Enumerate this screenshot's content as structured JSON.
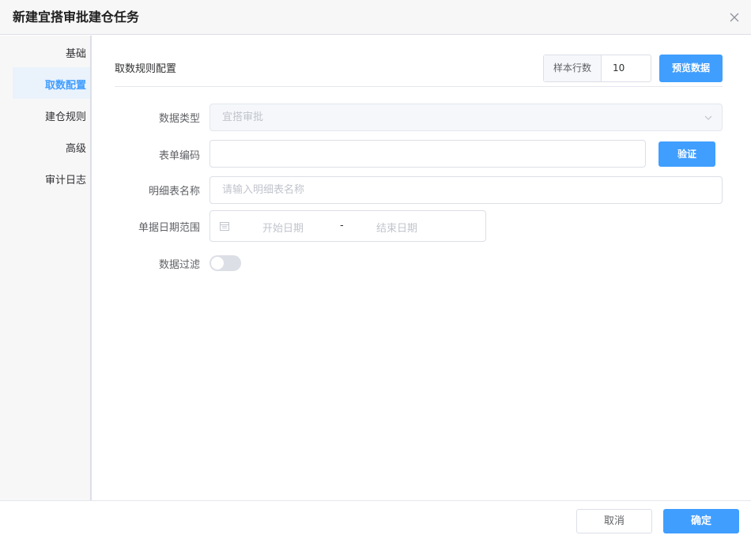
{
  "dialog": {
    "title": "新建宜搭审批建仓任务"
  },
  "sidebar": {
    "items": [
      {
        "label": "基础"
      },
      {
        "label": "取数配置"
      },
      {
        "label": "建仓规则"
      },
      {
        "label": "高级"
      },
      {
        "label": "审计日志"
      }
    ],
    "active_index": 1
  },
  "main": {
    "section_title": "取数规则配置",
    "sample": {
      "label": "样本行数",
      "value": "10"
    },
    "preview_button": "预览数据",
    "form": {
      "data_type": {
        "label": "数据类型",
        "value": "宜搭审批"
      },
      "form_code": {
        "label": "表单编码",
        "value": "",
        "verify_button": "验证"
      },
      "detail_table": {
        "label": "明细表名称",
        "placeholder": "请输入明细表名称"
      },
      "date_range": {
        "label": "单据日期范围",
        "start_placeholder": "开始日期",
        "separator": "-",
        "end_placeholder": "结束日期"
      },
      "data_filter": {
        "label": "数据过滤",
        "enabled": false
      }
    }
  },
  "footer": {
    "cancel": "取消",
    "confirm": "确定"
  },
  "colors": {
    "primary": "#409eff",
    "active_bg": "#eaf2fc"
  },
  "icons": {
    "close": "close-icon",
    "chevron": "chevron-down-icon",
    "calendar": "calendar-icon"
  }
}
